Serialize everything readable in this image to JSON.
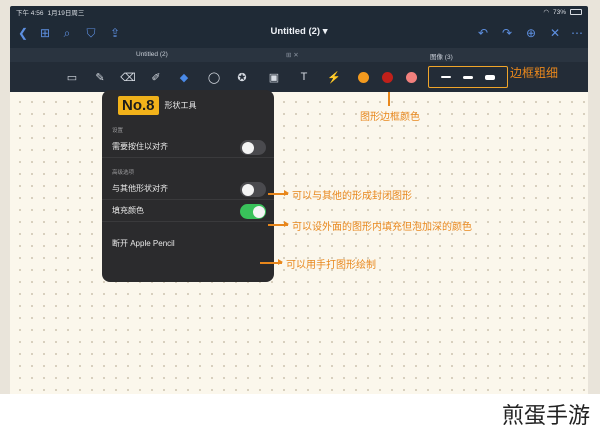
{
  "status_bar": {
    "time": "下午 4:56",
    "date": "1月19日周三",
    "battery": "73%"
  },
  "toolbar": {
    "title": "Untitled (2)",
    "title_caret": "▾"
  },
  "tabs": [
    {
      "label": "Untitled (2)"
    },
    {
      "label": "图像 (3)"
    }
  ],
  "colors": {
    "orange": "#f39a1e",
    "dark_red": "#c0201a",
    "pink": "#f2807d",
    "toggle_on": "#39c15a",
    "annotation": "#e8871c",
    "badge": "#f2b21a"
  },
  "popover": {
    "badge": "No.8",
    "title": "形状工具",
    "section1": "设置",
    "row1": {
      "label": "需要按住以对齐",
      "on": false
    },
    "section2": "高级选项",
    "row2": {
      "label": "与其他形状对齐",
      "on": false
    },
    "row3": {
      "label": "填充颜色",
      "on": true
    },
    "row4": {
      "label": "断开 Apple Pencil"
    }
  },
  "annotations": {
    "border_width": "边框粗细",
    "shape_border_color": "图形边框颜色",
    "snap": "可以与其他的形成封闭图形",
    "fill": "可以设外面的图形内填充但泡加深的颜色",
    "pencil": "可以用手打图形绘制"
  },
  "watermark": "煎蛋手游"
}
